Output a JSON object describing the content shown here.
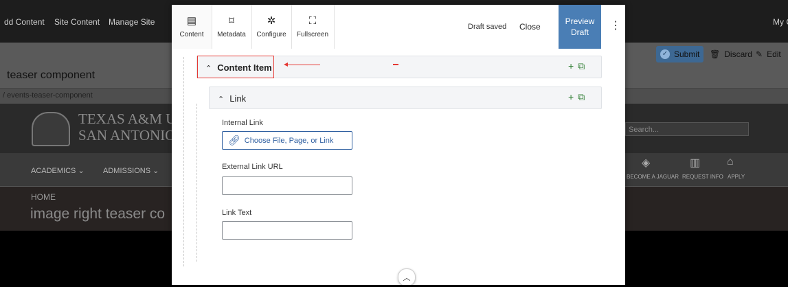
{
  "background": {
    "topbar": {
      "items": [
        "dd Content",
        "Site Content",
        "Manage Site"
      ],
      "right_text": "My C"
    },
    "page_title": "teaser component",
    "breadcrumb": "/ events-teaser-component",
    "actions": {
      "submit": "Submit",
      "discard": "Discard",
      "edit": "Edit"
    },
    "site": {
      "logo_line1": "TEXAS A&M UI",
      "logo_line2": "SAN ANTONIO",
      "search_placeholder": "Search...",
      "nav": [
        "ACADEMICS",
        "ADMISSIONS"
      ],
      "quick_links": [
        "BECOME A JAGUAR",
        "REQUEST INFO",
        "APPLY"
      ],
      "hero_crumb": "HOME",
      "hero_title": "image right teaser co"
    }
  },
  "dialog": {
    "tabs": [
      {
        "label": "Content",
        "icon": "content-icon"
      },
      {
        "label": "Metadata",
        "icon": "tag-icon"
      },
      {
        "label": "Configure",
        "icon": "gear-icon"
      },
      {
        "label": "Fullscreen",
        "icon": "fullscreen-icon"
      }
    ],
    "status": "Draft saved",
    "close": "Close",
    "preview_line1": "Preview",
    "preview_line2": "Draft",
    "content_item": "Content Item",
    "link_section": "Link",
    "fields": {
      "internal_label": "Internal Link",
      "internal_button": "Choose File, Page, or Link",
      "external_label": "External Link URL",
      "external_value": "",
      "text_label": "Link Text",
      "text_value": ""
    }
  },
  "colors": {
    "accent": "#4a7eb5",
    "annotation": "#e53935",
    "add": "#2e7d32"
  }
}
